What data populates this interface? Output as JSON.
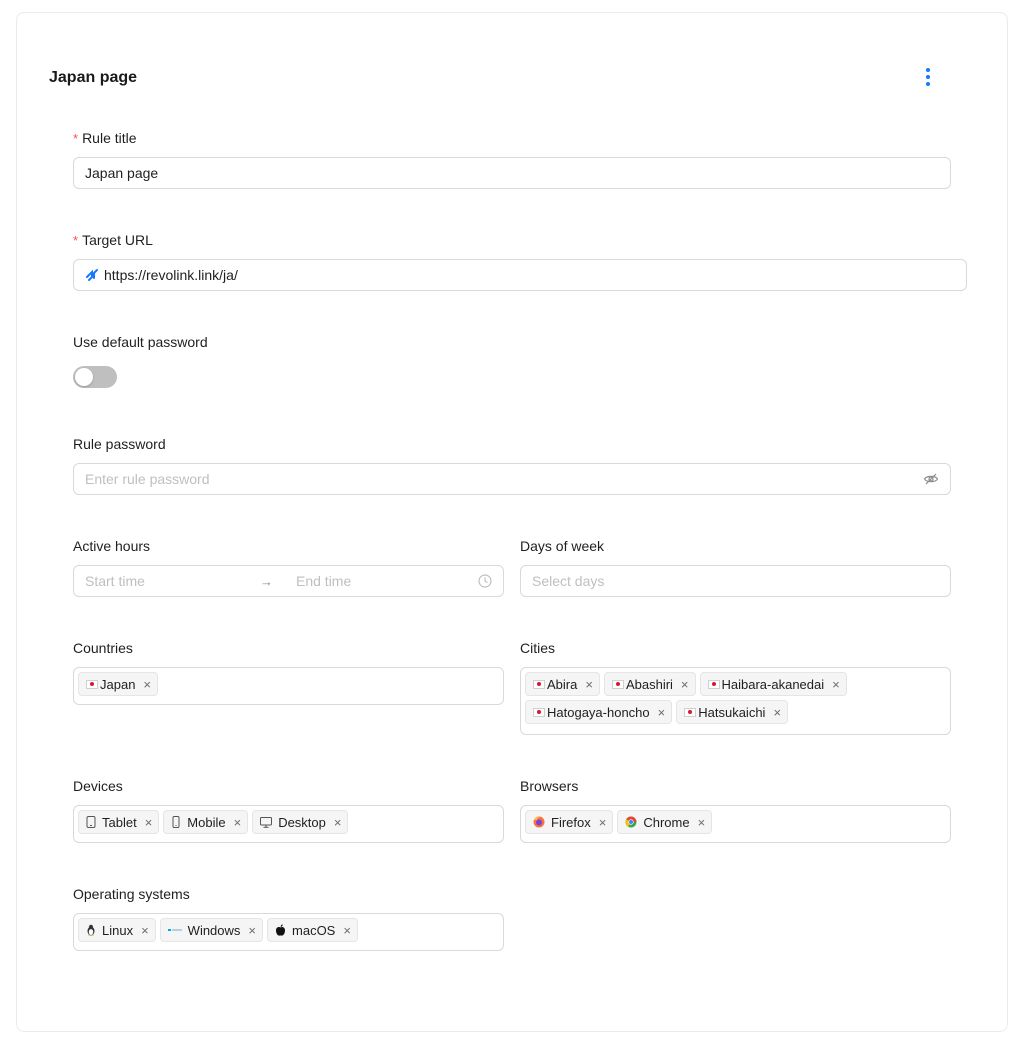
{
  "page": {
    "title": "Japan page"
  },
  "rule_title": {
    "label": "Rule title",
    "value": "Japan page"
  },
  "target_url": {
    "label": "Target URL",
    "value": "https://revolink.link/ja/"
  },
  "default_password": {
    "label": "Use default password",
    "enabled": false
  },
  "rule_password": {
    "label": "Rule password",
    "placeholder": "Enter rule password"
  },
  "active_hours": {
    "label": "Active hours",
    "start_placeholder": "Start time",
    "end_placeholder": "End time",
    "arrow": "→"
  },
  "days_of_week": {
    "label": "Days of week",
    "placeholder": "Select days"
  },
  "countries": {
    "label": "Countries",
    "items": [
      "Japan"
    ]
  },
  "cities": {
    "label": "Cities",
    "items": [
      "Abira",
      "Abashiri",
      "Haibara-akanedai",
      "Hatogaya-honcho",
      "Hatsukaichi"
    ]
  },
  "devices": {
    "label": "Devices",
    "items": [
      {
        "label": "Tablet",
        "icon": "tablet-icon"
      },
      {
        "label": "Mobile",
        "icon": "mobile-icon"
      },
      {
        "label": "Desktop",
        "icon": "desktop-icon"
      }
    ]
  },
  "browsers": {
    "label": "Browsers",
    "items": [
      {
        "label": "Firefox",
        "icon": "firefox-icon"
      },
      {
        "label": "Chrome",
        "icon": "chrome-icon"
      }
    ]
  },
  "operating_systems": {
    "label": "Operating systems",
    "items": [
      {
        "label": "Linux",
        "icon": "linux-icon"
      },
      {
        "label": "Windows",
        "icon": "windows-icon"
      },
      {
        "label": "macOS",
        "icon": "apple-icon"
      }
    ]
  },
  "remove_glyph": "×",
  "colors": {
    "accent": "#1677ff",
    "required": "#ff4d4f",
    "border": "#d9d9d9",
    "placeholder": "#bfbfbf",
    "toggle_off": "#bfbfbf"
  }
}
